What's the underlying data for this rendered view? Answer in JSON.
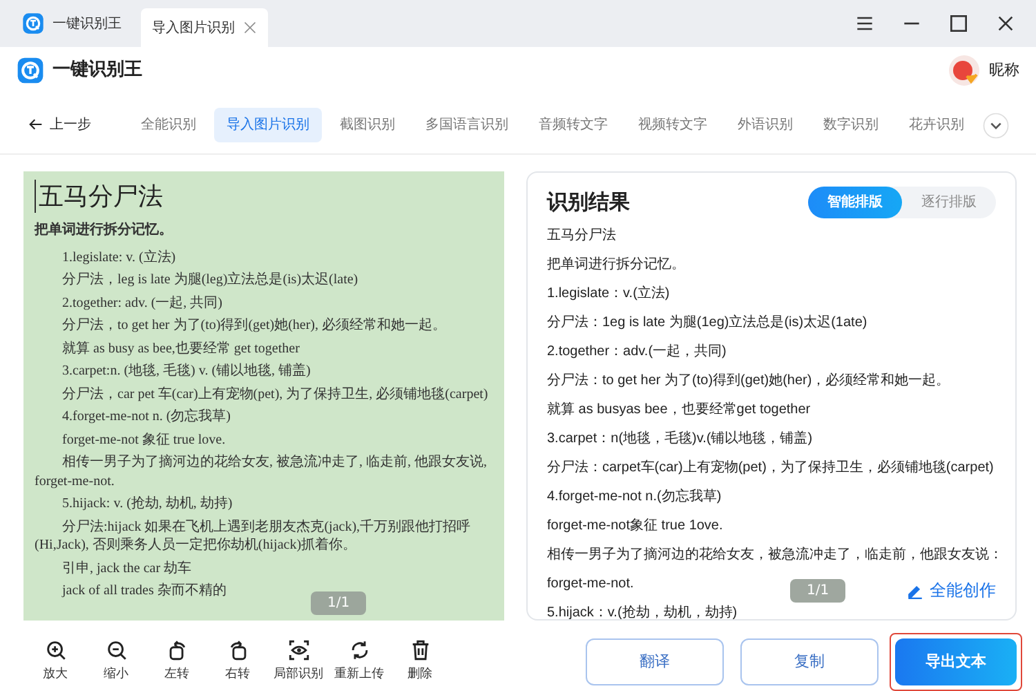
{
  "window": {
    "tabs": [
      {
        "label": "一键识别王",
        "kind": "app",
        "selected": false
      },
      {
        "label": "导入图片识别",
        "kind": "page",
        "selected": true
      }
    ]
  },
  "header": {
    "app_name": "一键识别王",
    "user_name": "昵称"
  },
  "nav": {
    "back": "上一步",
    "tabs": [
      {
        "label": "全能识别",
        "selected": false
      },
      {
        "label": "导入图片识别",
        "selected": true
      },
      {
        "label": "截图识别",
        "selected": false
      },
      {
        "label": "多国语言识别",
        "selected": false
      },
      {
        "label": "音频转文字",
        "selected": false
      },
      {
        "label": "视频转文字",
        "selected": false
      },
      {
        "label": "外语识别",
        "selected": false
      },
      {
        "label": "数字识别",
        "selected": false
      },
      {
        "label": "花卉识别",
        "selected": false
      }
    ]
  },
  "document": {
    "pager": "1/1",
    "lines": [
      {
        "kind": "title",
        "text": "五马分尸法"
      },
      {
        "kind": "bold",
        "text": "把单词进行拆分记忆。"
      },
      {
        "kind": "indent",
        "text": "1.legislate: v. (立法)"
      },
      {
        "kind": "indent",
        "text": "分尸法，leg is late 为腿(leg)立法总是(is)太迟(late)"
      },
      {
        "kind": "indent",
        "text": "2.together: adv. (一起, 共同)"
      },
      {
        "kind": "indent",
        "text": "分尸法，to get her 为了(to)得到(get)她(her), 必须经常和她一起。"
      },
      {
        "kind": "indent",
        "text": "就算 as busy as bee,也要经常 get together"
      },
      {
        "kind": "indent",
        "text": "3.carpet:n. (地毯, 毛毯) v. (铺以地毯, 铺盖)"
      },
      {
        "kind": "indent",
        "text": "分尸法，car pet 车(car)上有宠物(pet), 为了保持卫生, 必须铺地毯(carpet)"
      },
      {
        "kind": "indent",
        "text": "4.forget-me-not n. (勿忘我草)"
      },
      {
        "kind": "indent",
        "text": "forget-me-not 象征 true love."
      },
      {
        "kind": "indent",
        "text": "相传一男子为了摘河边的花给女友, 被急流冲走了, 临走前, 他跟女友说, forget-me-not."
      },
      {
        "kind": "indent",
        "text": "5.hijack: v. (抢劫, 劫机, 劫持)"
      },
      {
        "kind": "indent",
        "text": "分尸法:hijack 如果在飞机上遇到老朋友杰克(jack),千万别跟他打招呼(Hi,Jack), 否则乘务人员一定把你劫机(hijack)抓着你。"
      },
      {
        "kind": "indent",
        "text": "引申, jack the car 劫车"
      },
      {
        "kind": "indent",
        "text": "jack of all trades 杂而不精的"
      }
    ]
  },
  "result": {
    "title": "识别结果",
    "modes": [
      {
        "label": "智能排版",
        "selected": true
      },
      {
        "label": "逐行排版",
        "selected": false
      }
    ],
    "lines": [
      "五马分尸法",
      "把单词进行拆分记忆。",
      "1.legislate：v.(立法)",
      "分尸法：1eg is late 为腿(1eg)立法总是(is)太迟(1ate)",
      "2.together：adv.(一起，共同)",
      "分尸法：to get her 为了(to)得到(get)她(her)，必须经常和她一起。",
      "就算 as busyas bee，也要经常get together",
      "3.carpet：n(地毯，毛毯)v.(铺以地毯，铺盖)",
      "分尸法：carpet车(car)上有宠物(pet)，为了保持卫生，必须铺地毯(carpet)",
      "4.forget-me-not n.(勿忘我草)",
      "forget-me-not象征 true 1ove.",
      "相传一男子为了摘河边的花给女友，被急流冲走了，临走前，他跟女友说：",
      "forget-me-not.",
      "5.hijack：v.(抢劫，劫机，劫持)"
    ],
    "pager": "1/1",
    "create_link": "全能创作"
  },
  "tools": [
    {
      "kind": "zoom-in",
      "label": "放大"
    },
    {
      "kind": "zoom-out",
      "label": "缩小"
    },
    {
      "kind": "rotate-left",
      "label": "左转"
    },
    {
      "kind": "rotate-right",
      "label": "右转"
    },
    {
      "kind": "eye",
      "label": "局部识别"
    },
    {
      "kind": "refresh",
      "label": "重新上传"
    },
    {
      "kind": "trash",
      "label": "删除"
    }
  ],
  "actions": [
    {
      "label": "翻译",
      "kind": "outline"
    },
    {
      "label": "复制",
      "kind": "outline"
    },
    {
      "label": "导出文本",
      "kind": "primary",
      "highlighted": true
    }
  ]
}
